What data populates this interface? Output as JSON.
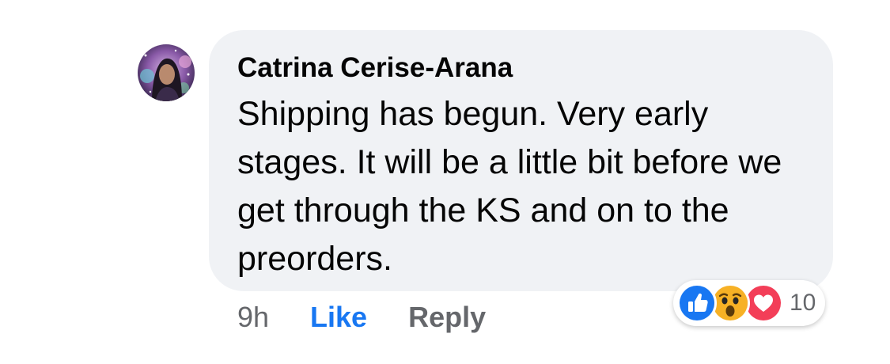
{
  "comment": {
    "author": "Catrina Cerise-Arana",
    "text": "Shipping has begun. Very early stages. It will be a little bit before we get through the KS and on to the preorders.",
    "avatar_icon": "user-avatar-photo"
  },
  "actions": {
    "timestamp": "9h",
    "like_label": "Like",
    "reply_label": "Reply"
  },
  "reactions": {
    "types": [
      "like-icon",
      "wow-icon",
      "love-icon"
    ],
    "count": "10"
  },
  "colors": {
    "bubble": "#f0f2f5",
    "like_blue": "#1877f2",
    "secondary_text": "#65676b",
    "love_red": "#f33e58",
    "wow_yellow": "#f7b125"
  }
}
